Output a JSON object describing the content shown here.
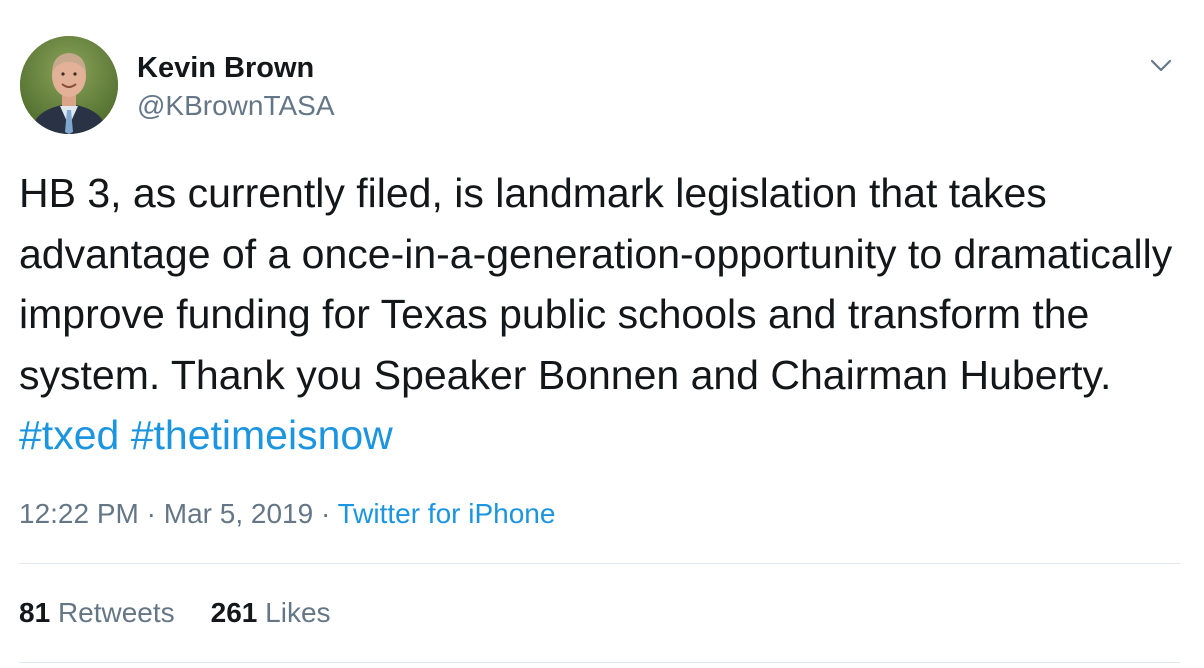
{
  "author": {
    "name": "Kevin Brown",
    "handle": "@KBrownTASA"
  },
  "menu": {
    "icon": "chevron-down-icon"
  },
  "tweet": {
    "text": "HB 3, as currently filed, is landmark legislation that takes advantage of a once-in-a-generation-opportunity to dramatically improve funding for Texas public schools and transform the system. Thank you Speaker Bonnen and Chairman Huberty. ",
    "hashtags": [
      "#txed",
      "#thetimeisnow"
    ]
  },
  "meta": {
    "time": "12:22 PM",
    "separator": " · ",
    "date": "Mar 5, 2019",
    "source": "Twitter for iPhone"
  },
  "stats": {
    "retweets": {
      "count": "81",
      "label": "Retweets"
    },
    "likes": {
      "count": "261",
      "label": "Likes"
    }
  },
  "colors": {
    "link": "#1b95e0",
    "secondary_text": "#657786",
    "primary_text": "#14171a",
    "divider": "#e1e8ed"
  }
}
